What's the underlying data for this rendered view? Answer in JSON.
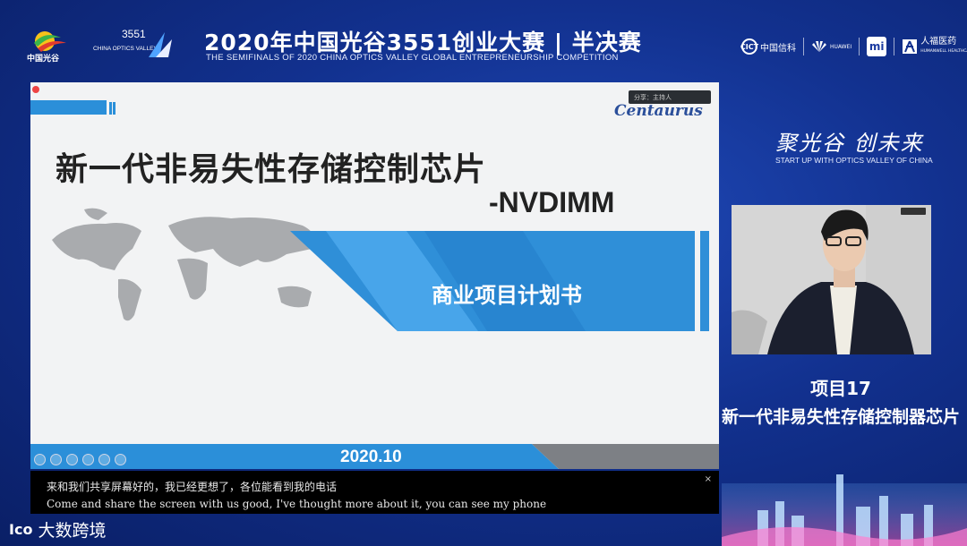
{
  "header": {
    "title_cn": "2020年中国光谷3551创业大赛 | 半决赛",
    "title_en": "THE SEMIFINALS OF 2020 CHINA OPTICS VALLEY GLOBAL ENTREPRENEURSHIP COMPETITION",
    "logo_left_text": "中国光谷",
    "logo_3551_number": "3551",
    "logo_3551_text": "CHINA OPTICS VALLEY",
    "sponsors": {
      "cict_abbr": "CICT",
      "cict": "中国信科",
      "huawei": "HUAWEI",
      "mi": "mi",
      "renfu": "人福医药",
      "renfu_en": "HUMANWELL HEALTHCARE"
    }
  },
  "slide": {
    "title": "新一代非易失性存储控制芯片",
    "subtitle": "-NVDIMM",
    "banner_text": "商业项目计划书",
    "date": "2020.10",
    "logo": "Centaurus",
    "share_chip": "分享：主持人"
  },
  "captions": {
    "cn": "来和我们共享屏幕好的，我已经更想了，各位能看到我的电话",
    "en": "Come and share the screen with us good, I've thought more about it, you can see my phone",
    "close": "×"
  },
  "watermark": {
    "logo": "Ico",
    "text": "大数跨境"
  },
  "right_panel": {
    "slogan_cn": "聚光谷 创未来",
    "slogan_en": "START UP WITH OPTICS VALLEY OF CHINA",
    "project_number": "项目17",
    "project_name": "新一代非易失性存储控制器芯片"
  },
  "colors": {
    "background": "#12318f",
    "accent_blue": "#2b8fd9",
    "banner_blue": "#2f8fd8"
  }
}
